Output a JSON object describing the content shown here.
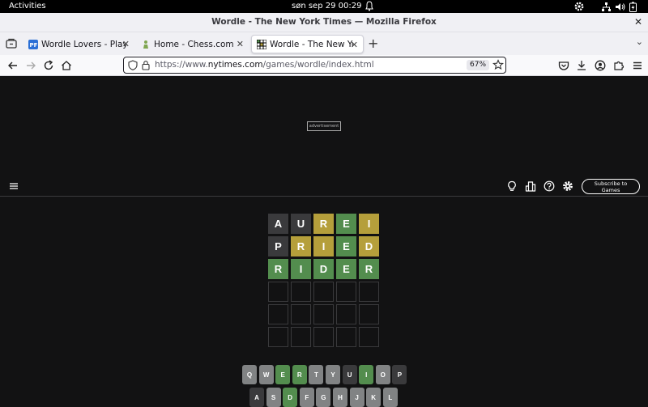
{
  "topbar": {
    "activities": "Activities",
    "clock": "søn sep 29  00:29"
  },
  "window": {
    "title": "Wordle - The New York Times — Mozilla Firefox"
  },
  "tabs": [
    {
      "label": "Wordle Lovers - Play th",
      "favicon": "wordle-lovers-favicon"
    },
    {
      "label": "Home - Chess.com",
      "favicon": "chess-pawn-favicon"
    },
    {
      "label": "Wordle - The New York",
      "favicon": "wordle-grid-favicon",
      "active": true
    }
  ],
  "navbar": {
    "url_prefix": "https://www.",
    "url_domain": "nytimes.com",
    "url_path": "/games/wordle/index.html",
    "zoom": "67%"
  },
  "page": {
    "ad_label": "advertisement",
    "subscribe_line1": "Subscribe to",
    "subscribe_line2": "Games"
  },
  "colors": {
    "absent": "#3a3a3c",
    "present": "#b59f3b",
    "correct": "#538d4e",
    "unused": "#818384",
    "background": "#121213"
  },
  "board": {
    "rows": [
      [
        {
          "l": "A",
          "s": "absent"
        },
        {
          "l": "U",
          "s": "absent"
        },
        {
          "l": "R",
          "s": "present"
        },
        {
          "l": "E",
          "s": "correct"
        },
        {
          "l": "I",
          "s": "present"
        }
      ],
      [
        {
          "l": "P",
          "s": "absent"
        },
        {
          "l": "R",
          "s": "present"
        },
        {
          "l": "I",
          "s": "present"
        },
        {
          "l": "E",
          "s": "correct"
        },
        {
          "l": "D",
          "s": "present"
        }
      ],
      [
        {
          "l": "R",
          "s": "correct"
        },
        {
          "l": "I",
          "s": "correct"
        },
        {
          "l": "D",
          "s": "correct"
        },
        {
          "l": "E",
          "s": "correct"
        },
        {
          "l": "R",
          "s": "correct"
        }
      ],
      [
        {
          "l": "",
          "s": "empty"
        },
        {
          "l": "",
          "s": "empty"
        },
        {
          "l": "",
          "s": "empty"
        },
        {
          "l": "",
          "s": "empty"
        },
        {
          "l": "",
          "s": "empty"
        }
      ],
      [
        {
          "l": "",
          "s": "empty"
        },
        {
          "l": "",
          "s": "empty"
        },
        {
          "l": "",
          "s": "empty"
        },
        {
          "l": "",
          "s": "empty"
        },
        {
          "l": "",
          "s": "empty"
        }
      ],
      [
        {
          "l": "",
          "s": "empty"
        },
        {
          "l": "",
          "s": "empty"
        },
        {
          "l": "",
          "s": "empty"
        },
        {
          "l": "",
          "s": "empty"
        },
        {
          "l": "",
          "s": "empty"
        }
      ]
    ]
  },
  "keyboard": {
    "row1": [
      {
        "k": "Q",
        "s": "unused"
      },
      {
        "k": "W",
        "s": "unused"
      },
      {
        "k": "E",
        "s": "correct"
      },
      {
        "k": "R",
        "s": "correct"
      },
      {
        "k": "T",
        "s": "unused"
      },
      {
        "k": "Y",
        "s": "unused"
      },
      {
        "k": "U",
        "s": "absent"
      },
      {
        "k": "I",
        "s": "correct"
      },
      {
        "k": "O",
        "s": "unused"
      },
      {
        "k": "P",
        "s": "absent"
      }
    ],
    "row2": [
      {
        "k": "A",
        "s": "absent"
      },
      {
        "k": "S",
        "s": "unused"
      },
      {
        "k": "D",
        "s": "correct"
      },
      {
        "k": "F",
        "s": "unused"
      },
      {
        "k": "G",
        "s": "unused"
      },
      {
        "k": "H",
        "s": "unused"
      },
      {
        "k": "J",
        "s": "unused"
      },
      {
        "k": "K",
        "s": "unused"
      },
      {
        "k": "L",
        "s": "unused"
      }
    ]
  }
}
